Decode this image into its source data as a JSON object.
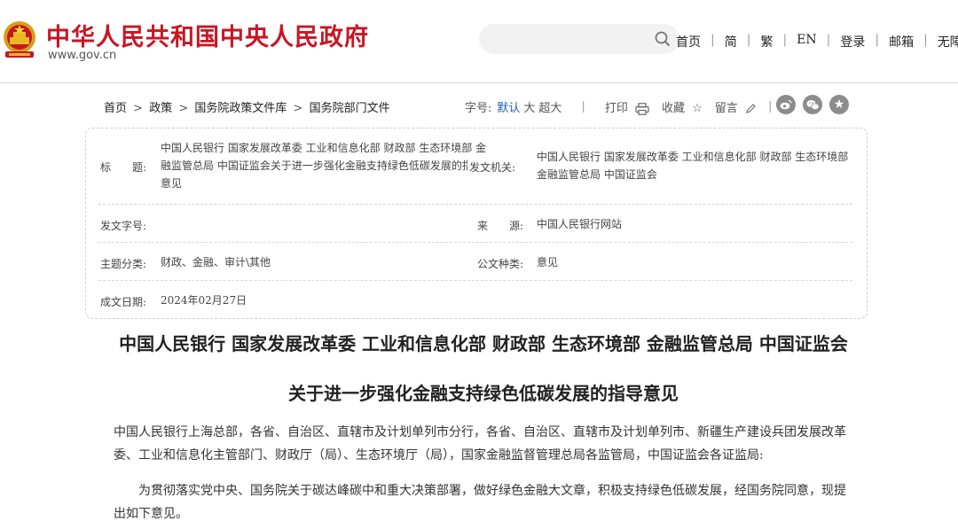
{
  "header": {
    "site_title": "中华人民共和国中央人民政府",
    "site_url": "www.gov.cn",
    "search_placeholder": "",
    "nav": [
      "首页",
      "简",
      "繁",
      "EN",
      "登录",
      "邮箱",
      "无障碍"
    ]
  },
  "breadcrumb": {
    "items": [
      "首页",
      "政策",
      "国务院政策文件库",
      "国务院部门文件"
    ],
    "separator": ">"
  },
  "toolbar": {
    "font_size_label": "字号:",
    "font_sizes": [
      "默认",
      "大",
      "超大"
    ],
    "print": "打印",
    "favorite": "收藏",
    "comment": "留言",
    "divider": "|"
  },
  "share": [
    "weibo-icon",
    "wechat-icon",
    "star-icon"
  ],
  "meta": {
    "title_label": "标　　题:",
    "title_value": "中国人民银行 国家发展改革委 工业和信息化部 财政部 生态环境部 金融监管总局 中国证监会关于进一步强化金融支持绿色低碳发展的指导意见",
    "issuer_label": "发文机关:",
    "issuer_value": "中国人民银行 国家发展改革委 工业和信息化部 财政部 生态环境部 金融监管总局 中国证监会",
    "doc_no_label": "发文字号:",
    "doc_no_value": "",
    "source_label": "来　　源:",
    "source_value": "中国人民银行网站",
    "topic_label": "主题分类:",
    "topic_value": "财政、金融、审计\\其他",
    "doc_type_label": "公文种类:",
    "doc_type_value": "意见",
    "date_label": "成文日期:",
    "date_value": "2024年02月27日"
  },
  "article": {
    "title_line1": "中国人民银行 国家发展改革委 工业和信息化部 财政部 生态环境部 金融监管总局 中国证监会",
    "title_line2": "关于进一步强化金融支持绿色低碳发展的指导意见",
    "para1": "中国人民银行上海总部，各省、自治区、直辖市及计划单列市分行，各省、自治区、直辖市及计划单列市、新疆生产建设兵团发展改革委、工业和信息化主管部门、财政厅（局）、生态环境厅（局），国家金融监督管理总局各监管局，中国证监会各证监局:",
    "para2": "为贯彻落实党中央、国务院关于碳达峰碳中和重大决策部署，做好绿色金融大文章，积极支持绿色低碳发展，经国务院同意，现提出如下意见。"
  },
  "colors": {
    "brand_red": "#c81623",
    "link_blue": "#1f5fae",
    "icon_gray": "#8c8c8c"
  }
}
